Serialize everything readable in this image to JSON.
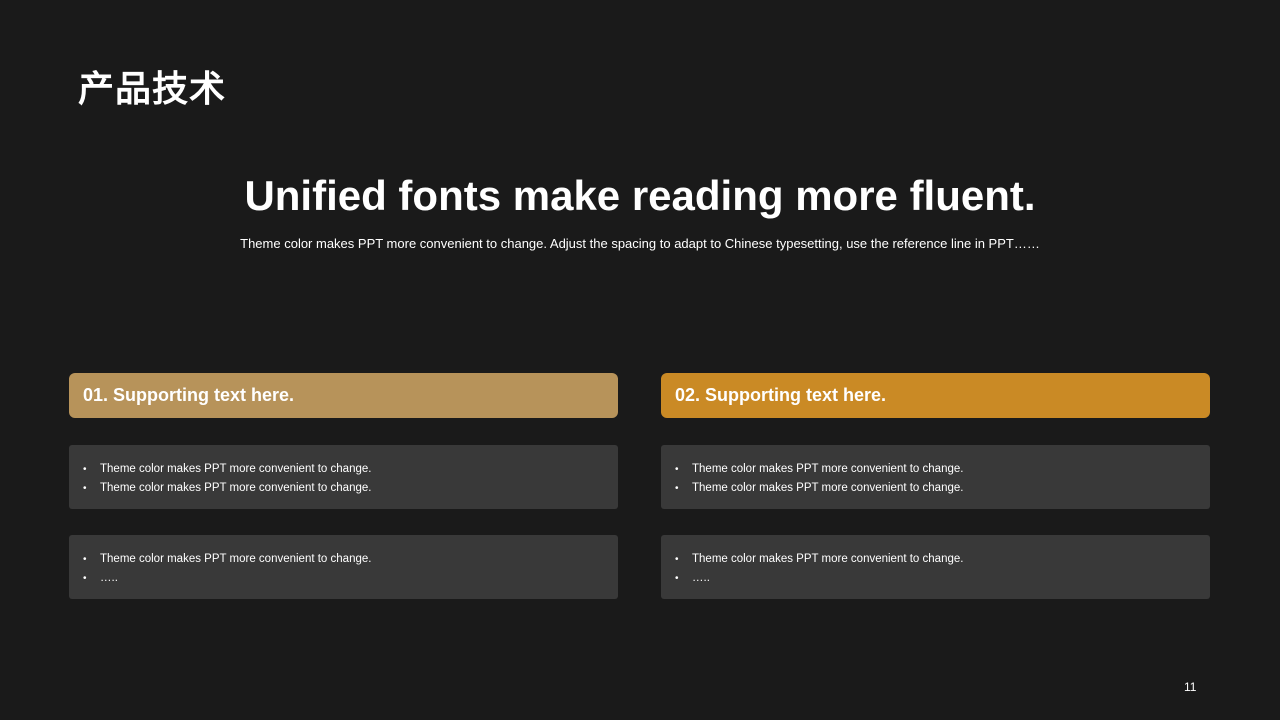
{
  "slide": {
    "title": "产品技术",
    "headline": "Unified fonts make reading more fluent.",
    "subheadline": "Theme color makes PPT more convenient to change. Adjust the spacing to adapt to Chinese typesetting, use the reference line in PPT……",
    "page_number": "11"
  },
  "colors": {
    "background": "#1a1a1a",
    "accent_1": "#b7935a",
    "accent_2": "#ca8a25",
    "box": "#393939"
  },
  "columns": [
    {
      "header": "01. Supporting text here.",
      "boxes": [
        [
          "Theme color makes PPT more convenient to change.",
          "Theme color makes PPT more convenient to change."
        ],
        [
          "Theme color makes PPT more convenient to change.",
          "….."
        ]
      ]
    },
    {
      "header": "02. Supporting text here.",
      "boxes": [
        [
          "Theme color makes PPT more convenient to change.",
          "Theme color makes PPT more convenient to change."
        ],
        [
          "Theme color makes PPT more convenient to change.",
          "….."
        ]
      ]
    }
  ],
  "bullet_glyph": "•"
}
